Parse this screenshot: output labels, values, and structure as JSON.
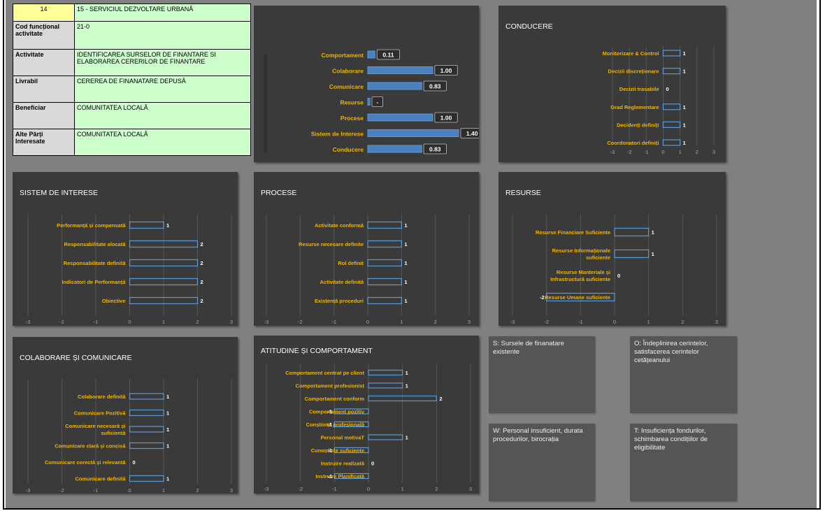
{
  "colors": {
    "label": "#f0b400",
    "bar_fill": "#4a7fc0",
    "bar_stroke": "#5b9bd5",
    "grid": "#555555",
    "panel": "#3a3a3a",
    "background": "#808080"
  },
  "info_table": {
    "number": "14",
    "department": "15 - SERVICIUL DEZVOLTARE URBANĂ",
    "rows": [
      {
        "label": "Cod funcțional activitate",
        "value": "21-0"
      },
      {
        "label": "Activitate",
        "value": "IDENTIFICAREA SURSELOR DE FINANTARE SI ELABORAREA CERERILOR DE FINANTARE"
      },
      {
        "label": "Livrabil",
        "value": "CEREREA DE FINANATARE DEPUSĂ"
      },
      {
        "label": "Beneficiar",
        "value": "COMUNITATEA LOCALĂ"
      },
      {
        "label": "Alte Părți Interesate",
        "value": "COMUNITATEA LOCALĂ"
      }
    ]
  },
  "chart_data": [
    {
      "id": "summary",
      "type": "bar",
      "title": "",
      "categories": [
        "Comportament",
        "Colaborare",
        "Comunicare",
        "Resurse",
        "Procese",
        "Sistem de Interese",
        "Conducere"
      ],
      "values": [
        0.11,
        1.0,
        0.83,
        0,
        1.0,
        1.4,
        0.83
      ],
      "data_labels": [
        "0.11",
        "1.00",
        "0.83",
        "-",
        "1.00",
        "1.40",
        "0.83"
      ],
      "xlim": [
        0,
        1.4
      ],
      "grid": false
    },
    {
      "id": "conducere",
      "type": "bar",
      "title": "CONDUCERE",
      "categories": [
        "Monitorizare & Control",
        "Decizii discreționare",
        "Decizii trasabile",
        "Grad Reglementare",
        "Decidenți definiți",
        "Coordonatori definiți"
      ],
      "values": [
        1,
        1,
        0,
        1,
        1,
        1
      ],
      "data_labels": [
        "1",
        "1",
        "0",
        "1",
        "1",
        "1"
      ],
      "xlim": [
        -3,
        3
      ],
      "xticks": [
        "-3",
        "-2",
        "-1",
        "0",
        "1",
        "2",
        "3"
      ],
      "grid": true
    },
    {
      "id": "sistem",
      "type": "bar",
      "title": "SISTEM DE INTERESE",
      "categories": [
        "Performanță și compensată",
        "Responsabilitate alocată",
        "Responsabilitate definită",
        "Indicatori de Performanță",
        "Obiective"
      ],
      "values": [
        1,
        2,
        2,
        2,
        2
      ],
      "data_labels": [
        "1",
        "2",
        "2",
        "2",
        "2"
      ],
      "xlim": [
        -3,
        3
      ],
      "xticks": [
        "-3",
        "-2",
        "-1",
        "0",
        "1",
        "2",
        "3"
      ],
      "grid": true
    },
    {
      "id": "procese",
      "type": "bar",
      "title": "PROCESE",
      "categories": [
        "Activitate conformă",
        "Resurse necesare definite",
        "Rol definit",
        "Activitate definită",
        "Existență proceduri"
      ],
      "values": [
        1,
        1,
        1,
        1,
        1
      ],
      "data_labels": [
        "1",
        "1",
        "1",
        "1",
        "1"
      ],
      "xlim": [
        -3,
        3
      ],
      "xticks": [
        "-3",
        "-2",
        "-1",
        "0",
        "1",
        "2",
        "3"
      ],
      "grid": true
    },
    {
      "id": "resurse",
      "type": "bar",
      "title": "RESURSE",
      "categories": [
        "Resurse Financiare Suficiente",
        "Resurse Informaționale suficiente",
        "Resurse Manteriale și Infrastructură suficiente",
        "Resurse Umane suficiente"
      ],
      "values": [
        1,
        1,
        0,
        -2
      ],
      "data_labels": [
        "1",
        "1",
        "0",
        "-2"
      ],
      "xlim": [
        -3,
        3
      ],
      "xticks": [
        "-3",
        "-2",
        "-1",
        "0",
        "1",
        "2",
        "3"
      ],
      "grid": true
    },
    {
      "id": "colaborare",
      "type": "bar",
      "title": "COLABORARE ȘI COMUNICARE",
      "categories": [
        "Colaborare definită",
        "Comunicare Pozitivă",
        "Comunicare necesară și suficientă",
        "Comunicare clară și concisă",
        "Comunicare corectă și relevantă",
        "Comunicare definită"
      ],
      "values": [
        1,
        1,
        1,
        1,
        0,
        1
      ],
      "data_labels": [
        "1",
        "1",
        "1",
        "1",
        "0",
        "1"
      ],
      "xlim": [
        -3,
        3
      ],
      "xticks": [
        "-3",
        "-2",
        "-1",
        "0",
        "1",
        "2",
        "3"
      ],
      "grid": true
    },
    {
      "id": "atitudine",
      "type": "bar",
      "title": "ATITUDINE ȘI COMPORTAMENT",
      "categories": [
        "Comportament centrat pe client",
        "Comportament profesionist",
        "Comportament conform",
        "Comportament pozitiv",
        "Conștiință profesională",
        "Personal motivaT",
        "Cunoștințe suficiente",
        "Instruire realizată",
        "Instruire Planificată"
      ],
      "values": [
        1,
        1,
        2,
        -1,
        -1,
        1,
        -1,
        0,
        -1
      ],
      "data_labels": [
        "1",
        "1",
        "2",
        "-1",
        "-1",
        "1",
        "-1",
        "0",
        "-1"
      ],
      "xlim": [
        -3,
        3
      ],
      "xticks": [
        "-3",
        "-2",
        "-1",
        "0",
        "1",
        "2",
        "3"
      ],
      "grid": true
    }
  ],
  "swot": {
    "s": "S: Sursele de finanatare existente",
    "o": "O: Îndeplinirea cerintelor, satisfacerea cerintelor cetățeanului",
    "w": "W: Personal insuficient, durata procedurilor, birocrația",
    "t": "T: Insuficiența fondurilor, schimbarea condițiilor de eligibilitate"
  }
}
